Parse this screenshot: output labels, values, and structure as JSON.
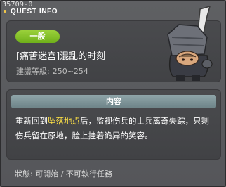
{
  "window": {
    "quest_id": "35709-0",
    "title": "QUEST INFO"
  },
  "header": {
    "tag_label": "一般",
    "quest_title": "[痛苦迷宫]混乱的时刻",
    "level_label": "建議等級:",
    "level_range": "250~254"
  },
  "content": {
    "header_label": "内容",
    "description_before": "重新回到",
    "description_highlight": "坠落地点",
    "description_after": "后，监视伤兵的士兵离奇失踪，只剩伤兵留在原地，脸上挂着诡异的笑容。"
  },
  "status": {
    "text": "狀態: 可開始 / 不可執行任務"
  },
  "colors": {
    "tag_green": "#7fbf26",
    "highlight_yellow": "#ffe246",
    "content_header": "#7f959a"
  }
}
